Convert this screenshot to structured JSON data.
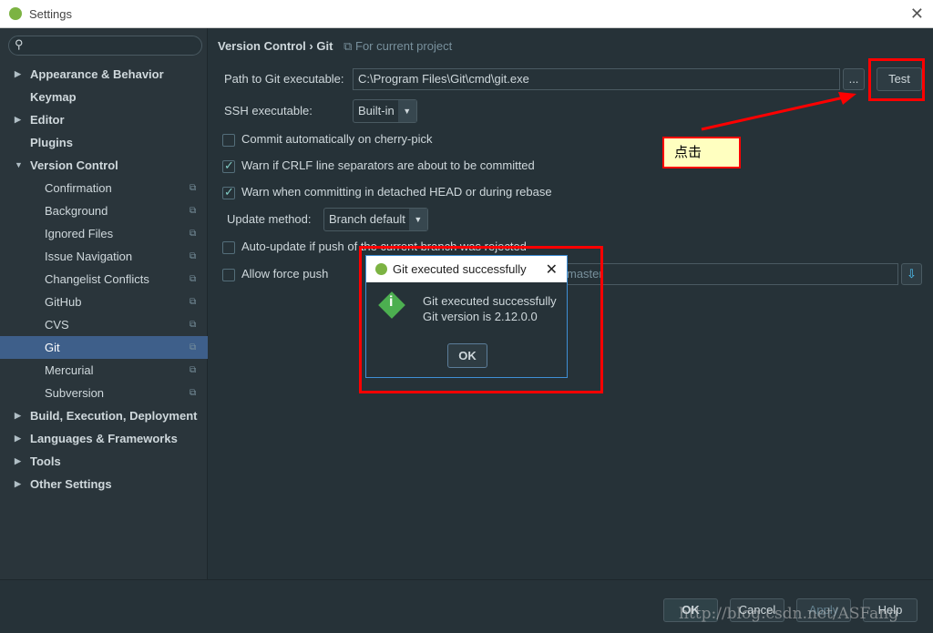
{
  "window": {
    "title": "Settings"
  },
  "sidebar": {
    "search_placeholder": "",
    "items": [
      {
        "label": "Appearance & Behavior",
        "level": 0,
        "expandable": true
      },
      {
        "label": "Keymap",
        "level": 0
      },
      {
        "label": "Editor",
        "level": 0,
        "expandable": true
      },
      {
        "label": "Plugins",
        "level": 0
      },
      {
        "label": "Version Control",
        "level": 0,
        "expanded": true
      },
      {
        "label": "Confirmation",
        "level": 1
      },
      {
        "label": "Background",
        "level": 1
      },
      {
        "label": "Ignored Files",
        "level": 1
      },
      {
        "label": "Issue Navigation",
        "level": 1
      },
      {
        "label": "Changelist Conflicts",
        "level": 1
      },
      {
        "label": "GitHub",
        "level": 1
      },
      {
        "label": "CVS",
        "level": 1
      },
      {
        "label": "Git",
        "level": 1,
        "selected": true
      },
      {
        "label": "Mercurial",
        "level": 1
      },
      {
        "label": "Subversion",
        "level": 1
      },
      {
        "label": "Build, Execution, Deployment",
        "level": 0,
        "expandable": true
      },
      {
        "label": "Languages & Frameworks",
        "level": 0,
        "expandable": true
      },
      {
        "label": "Tools",
        "level": 0,
        "expandable": true
      },
      {
        "label": "Other Settings",
        "level": 0,
        "expandable": true
      }
    ]
  },
  "main": {
    "breadcrumb": {
      "parent": "Version Control",
      "sep": "›",
      "current": "Git",
      "scope": "For current project"
    },
    "path_label": "Path to Git executable:",
    "path_value": "C:\\Program Files\\Git\\cmd\\git.exe",
    "browse": "...",
    "test": "Test",
    "ssh_label": "SSH executable:",
    "ssh_value": "Built-in",
    "checkboxes": [
      {
        "label": "Commit automatically on cherry-pick",
        "checked": false
      },
      {
        "label": "Warn if CRLF line separators are about to be committed",
        "checked": true
      },
      {
        "label": "Warn when committing in detached HEAD or during rebase",
        "checked": true
      }
    ],
    "update_label": "Update method:",
    "update_value": "Branch default",
    "autoupdate": {
      "label": "Auto-update if push of the current branch was rejected",
      "checked": false
    },
    "forcepush": {
      "label": "Allow force push",
      "checked": false
    },
    "protected_value": "master",
    "annotation": "点击"
  },
  "dialog": {
    "title": "Git executed successfully",
    "line1": "Git executed successfully",
    "line2": "Git version is 2.12.0.0",
    "ok": "OK"
  },
  "footer": {
    "ok": "OK",
    "cancel": "Cancel",
    "apply": "Apply",
    "help": "Help"
  },
  "watermark": "http://blog.csdn.net/ASFang",
  "colors": {
    "selection": "#3e5f8a",
    "annotation": "#ff0000",
    "accent": "#80cbc4"
  }
}
